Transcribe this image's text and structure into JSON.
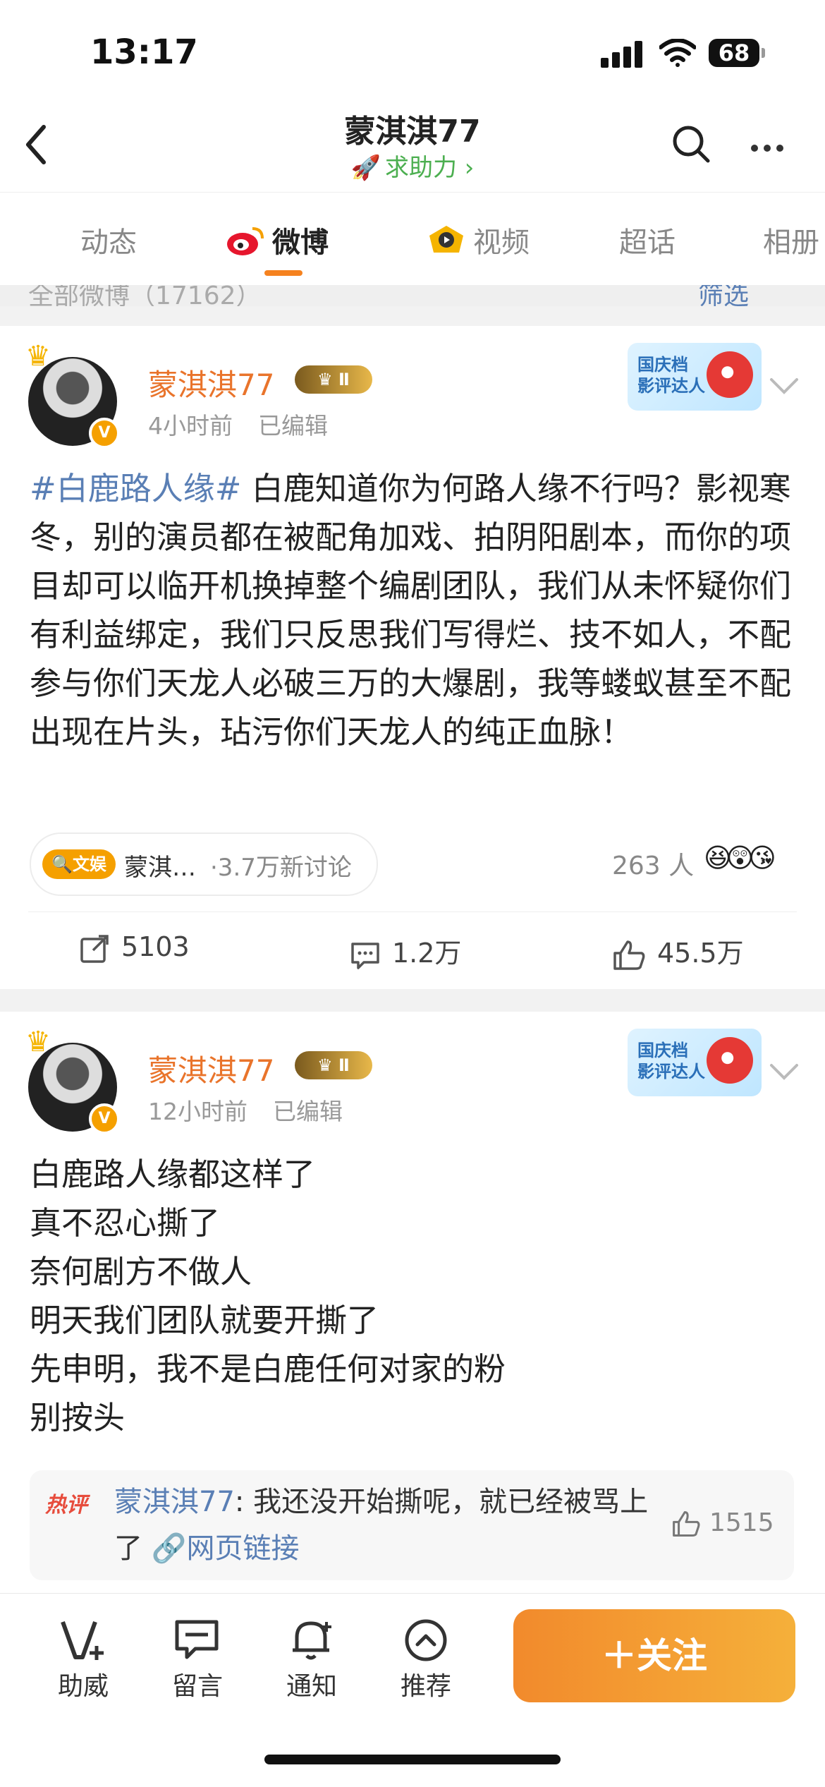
{
  "status_bar": {
    "time": "13:17",
    "battery": "68"
  },
  "header": {
    "title": "蒙淇淇77",
    "helper": "求助力 ›"
  },
  "tabs": [
    {
      "label": "动态"
    },
    {
      "label": "微博"
    },
    {
      "label": "视频"
    },
    {
      "label": "超话"
    },
    {
      "label": "相册"
    }
  ],
  "filter": {
    "label": "全部微博（17162）",
    "button": "筛选"
  },
  "posts": [
    {
      "author": "蒙淇淇77",
      "level": "Ⅱ",
      "time": "4小时前",
      "edited": "已编辑",
      "promo_badge": "国庆档 影评达人",
      "hashtag": "#白鹿路人缘#",
      "text": " 白鹿知道你为何路人缘不行吗？影视寒冬，别的演员都在被配角加戏、拍阴阳剧本，而你的项目却可以临开机换掉整个编剧团队，我们从未怀疑你们有利益绑定，我们只反思我们写得烂、技不如人，不配参与你们天龙人必破三万的大爆剧，我等蝼蚁甚至不配出现在片头，玷污你们天龙人的纯正血脉！",
      "topic_badge": "文娱",
      "topic_name": "蒙淇…",
      "topic_count": "·3.7万新讨论",
      "reactions_count": "263 人",
      "reposts": "5103",
      "comments": "1.2万",
      "likes": "45.5万"
    },
    {
      "author": "蒙淇淇77",
      "level": "Ⅱ",
      "time": "12小时前",
      "edited": "已编辑",
      "promo_badge": "国庆档 影评达人",
      "lines": [
        "白鹿路人缘都这样了",
        "真不忍心撕了",
        "奈何剧方不做人",
        "明天我们团队就要开撕了",
        "先申明，我不是白鹿任何对家的粉",
        "别按头"
      ],
      "hot_comment": {
        "tag": "热评",
        "user": "蒙淇淇77",
        "text": ": 我还没开始撕呢，就已经被骂上了",
        "link": "网页链接",
        "likes": "1515"
      }
    }
  ],
  "bottom_nav": [
    {
      "label": "助威",
      "icon": "cheer-icon"
    },
    {
      "label": "留言",
      "icon": "message-icon"
    },
    {
      "label": "通知",
      "icon": "bell-icon"
    },
    {
      "label": "推荐",
      "icon": "recommend-icon"
    }
  ],
  "follow_button": "＋关注",
  "colors": {
    "accent": "#f5821f",
    "name": "#e9742b",
    "link": "#5a7fb5"
  }
}
